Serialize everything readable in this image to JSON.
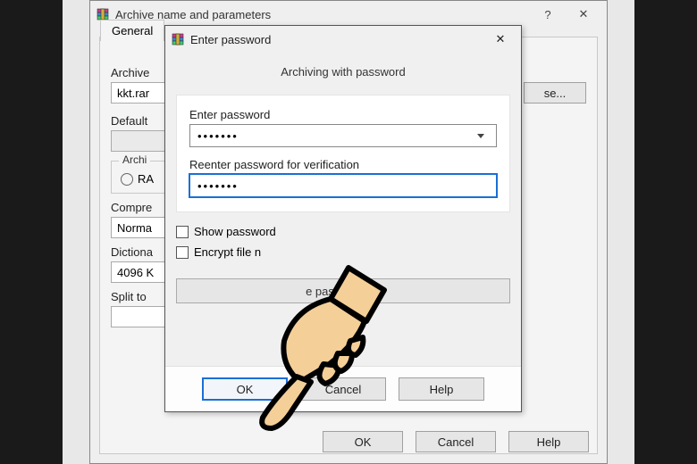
{
  "parent_dialog": {
    "title": "Archive name and parameters",
    "help_glyph": "?",
    "close_glyph": "✕",
    "tab_general": "General",
    "archive_name_label": "Archive",
    "archive_name_value": "kkt.rar",
    "browse_button": "se...",
    "default_label": "Default",
    "format_legend": "Archi",
    "format_rar": "RA",
    "compression_label": "Compre",
    "compression_value": "Norma",
    "dictionary_label": "Dictiona",
    "dictionary_value": "4096 K",
    "split_label": "Split to",
    "ok": "OK",
    "cancel": "Cancel",
    "help": "Help"
  },
  "password_dialog": {
    "title": "Enter password",
    "close_glyph": "✕",
    "subtitle": "Archiving with password",
    "enter_label": "Enter password",
    "enter_value": "•••••••",
    "reenter_label": "Reenter password for verification",
    "reenter_value": "•••••••",
    "show_password": "Show password",
    "encrypt_filenames": "Encrypt file n",
    "organize": "e passwords...",
    "ok": "OK",
    "cancel": "Cancel",
    "help": "Help"
  }
}
